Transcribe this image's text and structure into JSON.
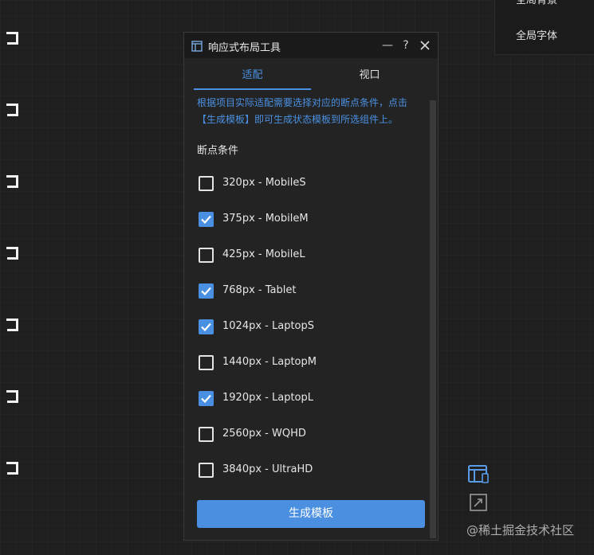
{
  "right_panel": {
    "items": [
      "全局背景",
      "全局字体"
    ]
  },
  "dialog": {
    "title": "响应式布局工具",
    "minimize_symbol": "—",
    "help_symbol": "?",
    "tabs": [
      {
        "label": "适配",
        "active": true
      },
      {
        "label": "视口",
        "active": false
      }
    ],
    "description": "根据项目实际适配需要选择对应的断点条件，点击【生成模板】即可生成状态模板到所选组件上。",
    "section_label": "断点条件",
    "breakpoints": [
      {
        "label": "320px - MobileS",
        "checked": false
      },
      {
        "label": "375px - MobileM",
        "checked": true
      },
      {
        "label": "425px - MobileL",
        "checked": false
      },
      {
        "label": "768px - Tablet",
        "checked": true
      },
      {
        "label": "1024px - LaptopS",
        "checked": true
      },
      {
        "label": "1440px - LaptopM",
        "checked": false
      },
      {
        "label": "1920px - LaptopL",
        "checked": true
      },
      {
        "label": "2560px - WQHD",
        "checked": false
      },
      {
        "label": "3840px - UltraHD",
        "checked": false
      }
    ],
    "generate_button": "生成模板"
  },
  "watermark": "@稀土掘金技术社区",
  "colors": {
    "accent": "#4a90e2",
    "background": "#1f1f1f",
    "panel": "#232323"
  },
  "icons": [
    "window-icon",
    "close-icon",
    "responsive-layout-icon",
    "resize-icon"
  ]
}
